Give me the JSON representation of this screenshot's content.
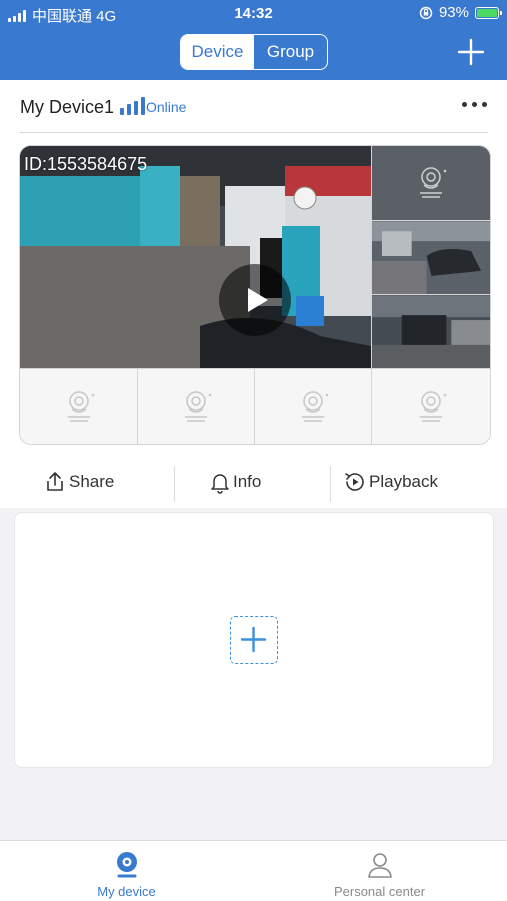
{
  "status_bar": {
    "carrier": "中国联通 4G",
    "time": "14:32",
    "battery": "93%",
    "battery_level": 0.93
  },
  "header": {
    "tabs": [
      {
        "label": "Device",
        "active": true
      },
      {
        "label": "Group",
        "active": false
      }
    ],
    "add_icon": "plus-icon"
  },
  "device": {
    "name": "My Device1",
    "status": "Online",
    "signal_icon": "signal-bars-icon",
    "more_icon": "more-dots-icon",
    "main_channel_id": "ID:1553584675",
    "play_icon": "play-icon",
    "channel_placeholder_icon": "camera-icon"
  },
  "actions": {
    "share": "Share",
    "info": "Info",
    "playback": "Playback"
  },
  "add_device_icon": "plus-icon",
  "tabbar": {
    "items": [
      {
        "label": "My device",
        "active": true,
        "icon": "camera-icon"
      },
      {
        "label": "Personal center",
        "active": false,
        "icon": "person-icon"
      }
    ]
  },
  "colors": {
    "primary": "#3a79d0",
    "inactive_tab": "#8a8a8a",
    "text": "#333333"
  }
}
